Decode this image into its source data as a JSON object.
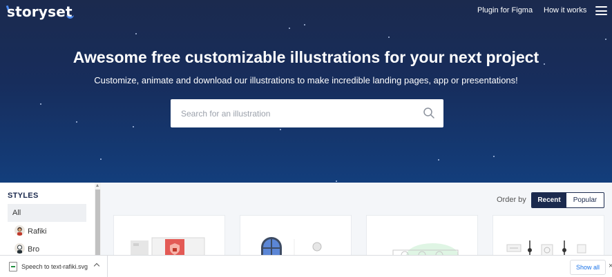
{
  "header": {
    "logo_text": "storyset",
    "nav": [
      "Plugin for Figma",
      "How it works"
    ],
    "menu_icon": "hamburger-menu-icon"
  },
  "hero": {
    "title": "Awesome free customizable illustrations for your next project",
    "subtitle": "Customize, animate and download our illustrations to make incredible landing pages, app or presentations!",
    "search": {
      "placeholder": "Search for an illustration",
      "icon": "search-icon"
    }
  },
  "sidebar": {
    "heading": "STYLES",
    "items": [
      {
        "label": "All",
        "active": true
      },
      {
        "label": "Rafiki",
        "icon": "rafiki-avatar-icon"
      },
      {
        "label": "Bro",
        "icon": "bro-avatar-icon"
      }
    ]
  },
  "order": {
    "label": "Order by",
    "options": [
      "Recent",
      "Popular"
    ],
    "selected": "Recent"
  },
  "download_bar": {
    "file_name": "Speech to text-rafiki.svg",
    "show_all": "Show all"
  },
  "colors": {
    "hero_top": "#1b2a4e",
    "hero_bottom": "#133e7c",
    "brand_accent": "#4d8af0",
    "dark_navy": "#1b2a4e",
    "link_blue": "#1a73e8"
  }
}
